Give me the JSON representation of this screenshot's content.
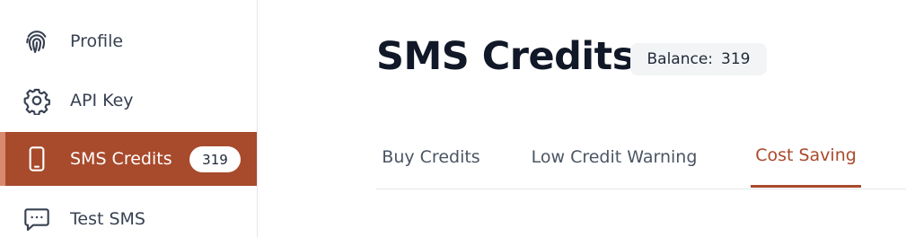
{
  "sidebar": {
    "items": [
      {
        "label": "Profile",
        "icon": "fingerprint-icon"
      },
      {
        "label": "API Key",
        "icon": "gear-icon"
      },
      {
        "label": "SMS Credits",
        "icon": "mobile-phone-icon",
        "count": "319",
        "active": true
      },
      {
        "label": "Test SMS",
        "icon": "chat-bubble-icon"
      }
    ]
  },
  "header": {
    "title": "SMS Credits",
    "balance_label": "Balance:",
    "balance_value": "319"
  },
  "tabs": [
    {
      "label": "Buy Credits"
    },
    {
      "label": "Low Credit Warning"
    },
    {
      "label": "Cost Saving",
      "active": true
    }
  ],
  "colors": {
    "accent": "#a84a2c",
    "accent_stripe": "#d98a6e",
    "badge_bg": "#f3f4f6"
  }
}
